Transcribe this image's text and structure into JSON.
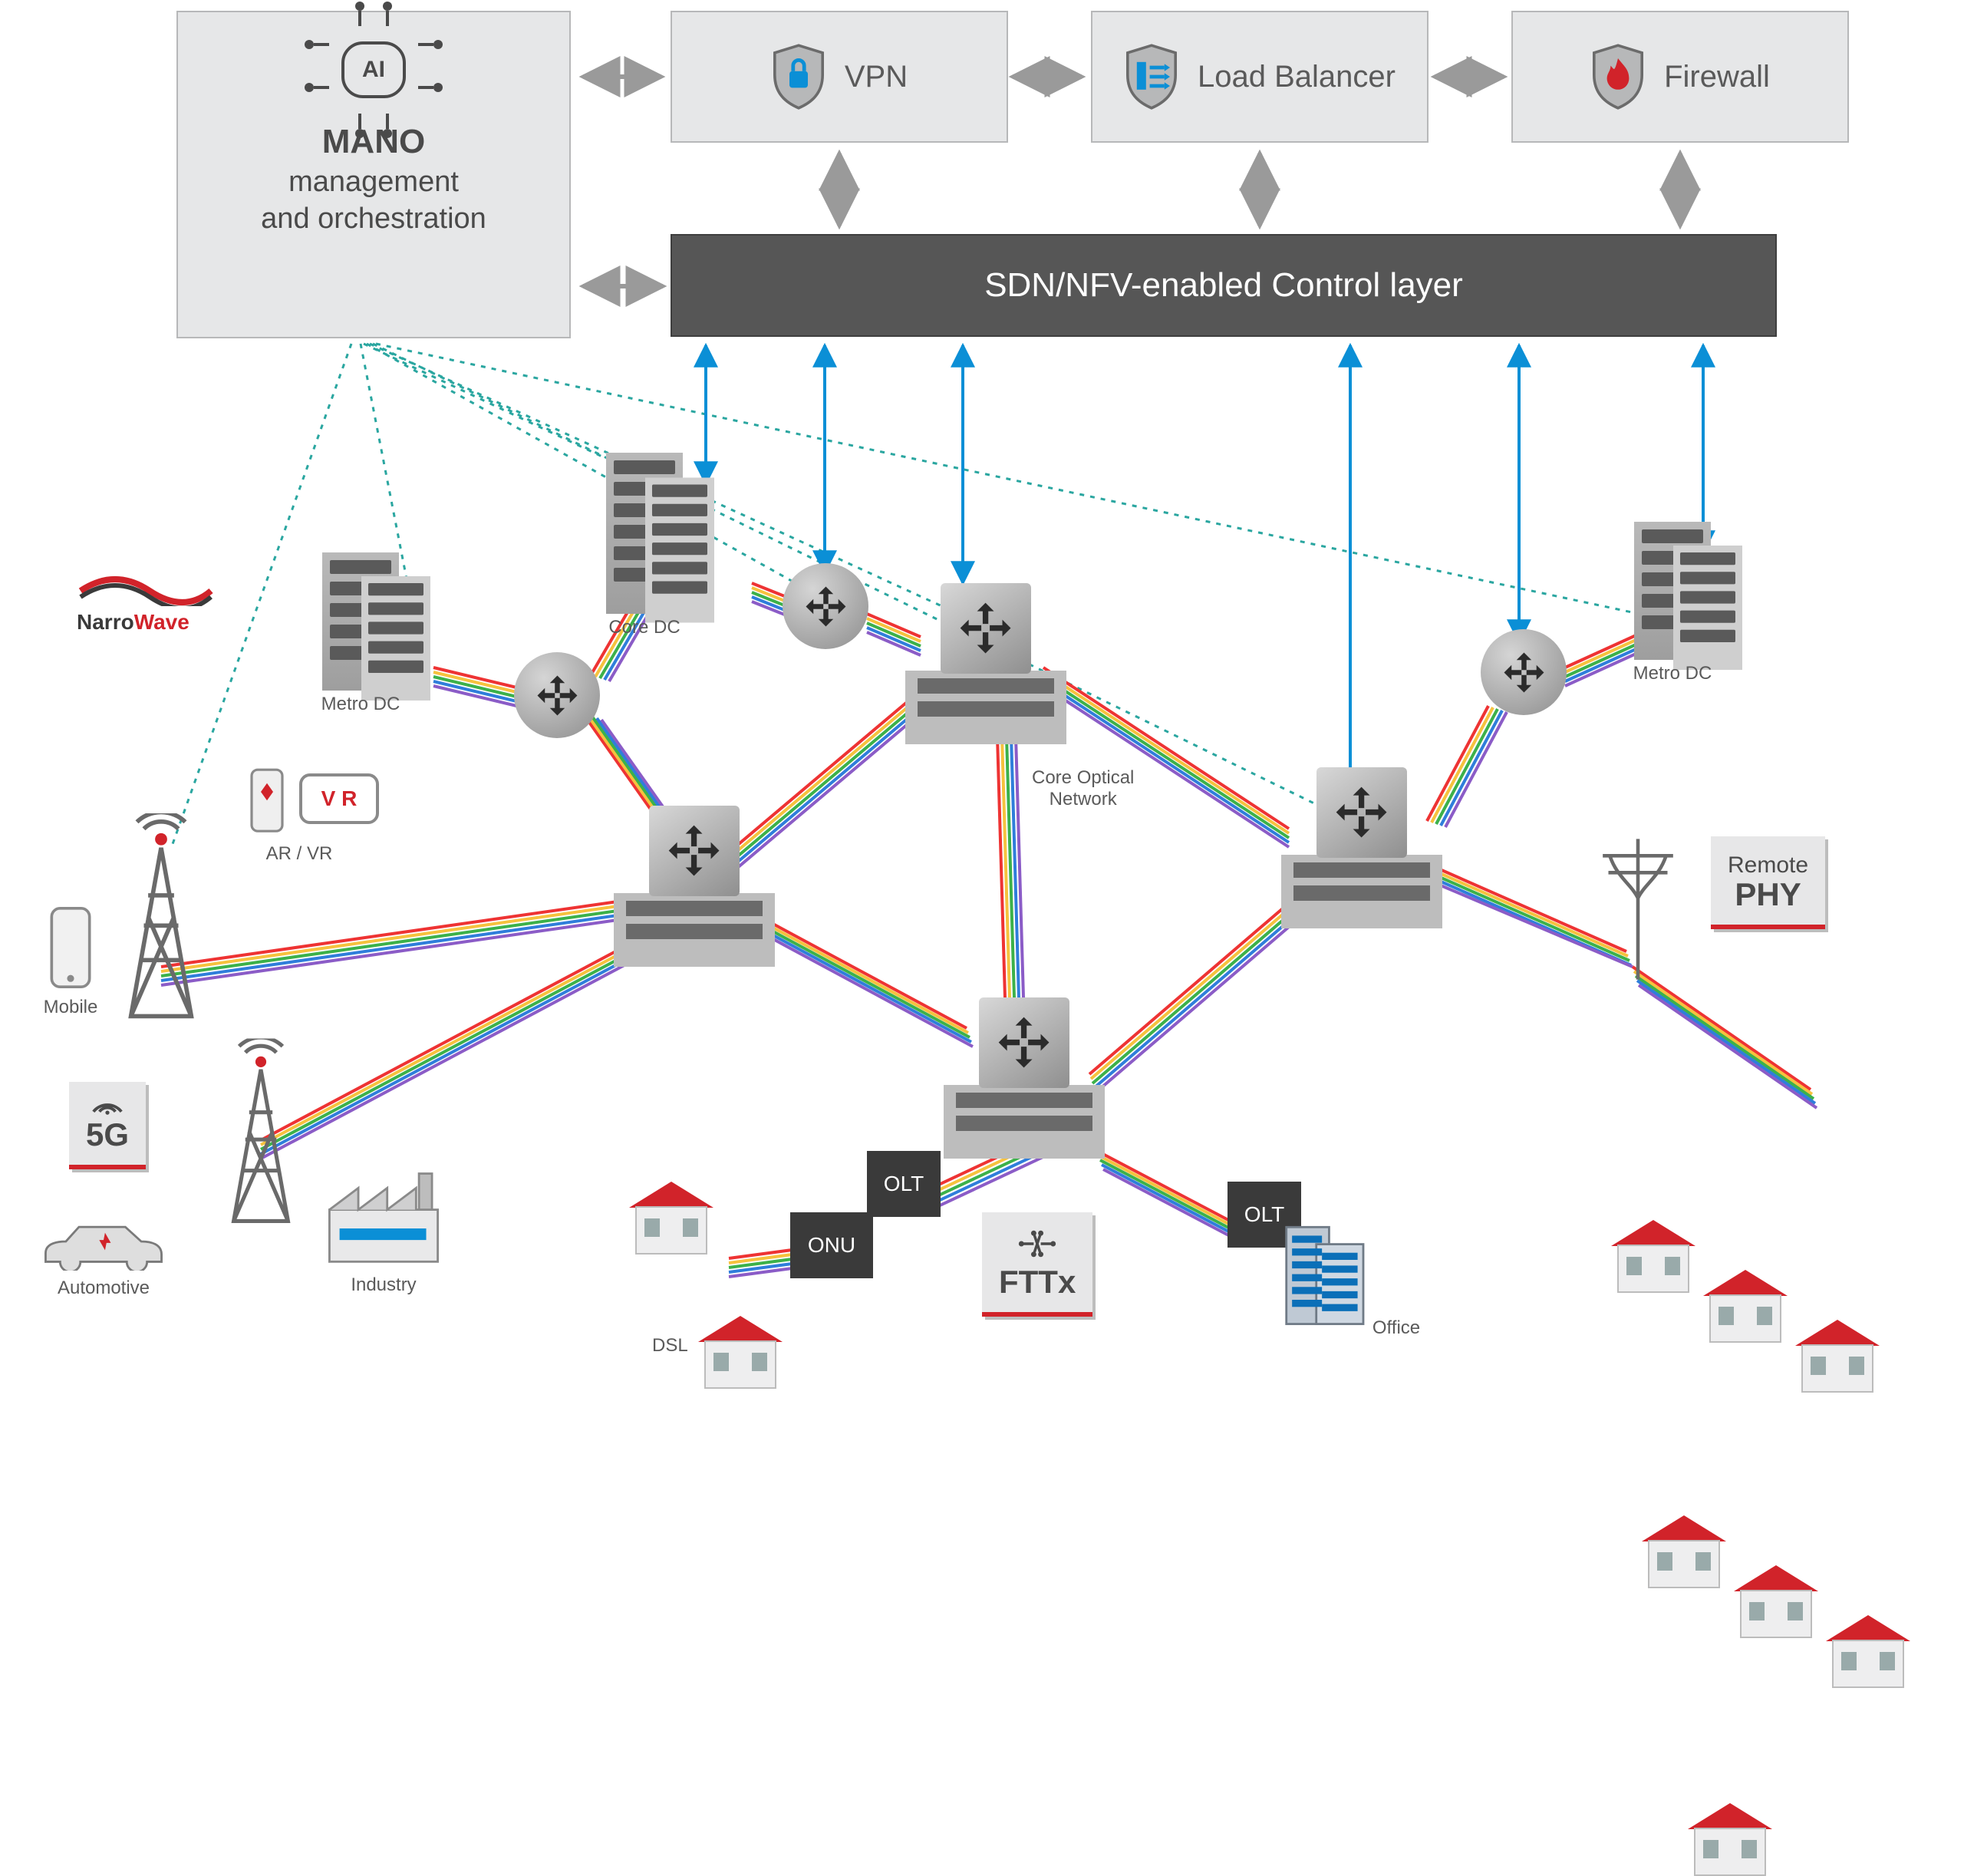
{
  "mano": {
    "ai_label": "AI",
    "title": "MANO",
    "subtitle": "management\nand orchestration"
  },
  "vnf": {
    "vpn": "VPN",
    "lb": "Load Balancer",
    "fw": "Firewall"
  },
  "control_layer": "SDN/NFV-enabled Control layer",
  "labels": {
    "metro_dc_l": "Metro DC",
    "metro_dc_r": "Metro DC",
    "core_dc": "Core DC",
    "core_optical": "Core Optical\nNetwork",
    "arvr": "AR / VR",
    "mobile": "Mobile",
    "g5": "5G",
    "auto": "Automotive",
    "industry": "Industry",
    "dsl": "DSL",
    "olt": "OLT",
    "onu": "ONU",
    "fttx": "FTTx",
    "office": "Office",
    "remote_phy_top": "Remote",
    "remote_phy_bot": "PHY",
    "narrowave_a": "Narro",
    "narrowave_b": "Wave",
    "vr_badge": "V R"
  }
}
